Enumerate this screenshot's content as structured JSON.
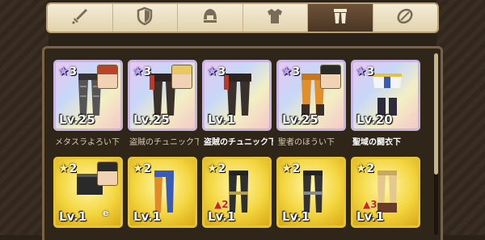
{
  "tabs": [
    {
      "icon": "sword-icon",
      "active": false
    },
    {
      "icon": "shield-icon",
      "active": false
    },
    {
      "icon": "helmet-icon",
      "active": false
    },
    {
      "icon": "armor-top-icon",
      "active": false
    },
    {
      "icon": "armor-bottom-icon",
      "active": true
    },
    {
      "icon": "accessory-icon",
      "active": false
    }
  ],
  "items": [
    {
      "stars": "3",
      "level": "Lv.25",
      "name": "メタスラよろい下",
      "rarity": "rainbow",
      "owner": true
    },
    {
      "stars": "3",
      "level": "Lv.25",
      "name": "盗賊のチュニック下",
      "rarity": "rainbow",
      "owner": true
    },
    {
      "stars": "3",
      "level": "Lv.1",
      "name": "盗賊のチュニック下",
      "rarity": "rainbow",
      "owner": false
    },
    {
      "stars": "3",
      "level": "Lv.25",
      "name": "聖者のほうい下",
      "rarity": "rainbow",
      "owner": true
    },
    {
      "stars": "3",
      "level": "Lv.20",
      "name": "聖域の闘衣下",
      "rarity": "rainbow",
      "owner": false
    },
    {
      "stars": "2",
      "level": "Lv.1",
      "name": "",
      "rarity": "gold",
      "owner": true,
      "mark": "e"
    },
    {
      "stars": "2",
      "level": "Lv.1",
      "name": "",
      "rarity": "gold",
      "owner": false
    },
    {
      "stars": "2",
      "level": "Lv.1",
      "name": "",
      "rarity": "gold",
      "owner": false,
      "mod": "▲2"
    },
    {
      "stars": "2",
      "level": "Lv.1",
      "name": "",
      "rarity": "gold",
      "owner": false
    },
    {
      "stars": "2",
      "level": "Lv.1",
      "name": "",
      "rarity": "gold",
      "owner": false,
      "mod": "▲3"
    }
  ],
  "colors": {
    "accent_active_tab": "#5a4230",
    "frame": "#7a6244",
    "rainbow": "#e9c7f2",
    "gold": "#f4d640"
  }
}
